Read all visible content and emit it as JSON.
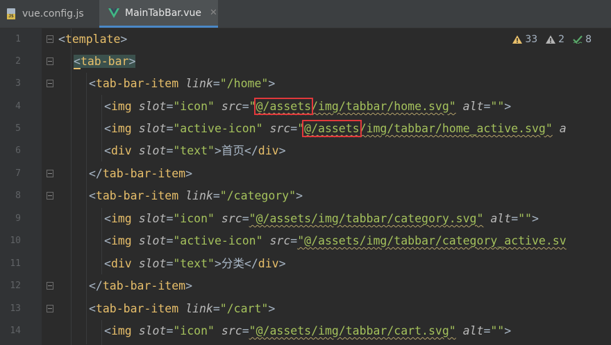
{
  "tabs": [
    {
      "label": "vue.config.js",
      "icon": "js-file-icon",
      "active": false
    },
    {
      "label": "MainTabBar.vue",
      "icon": "vue-file-icon",
      "active": true,
      "close": "✕"
    }
  ],
  "js_badge": "JS",
  "inspections": {
    "warnings": "33",
    "weak_warnings": "2",
    "typos": "8"
  },
  "line_numbers": [
    "1",
    "2",
    "3",
    "4",
    "5",
    "6",
    "7",
    "8",
    "9",
    "10",
    "11",
    "12",
    "13",
    "14"
  ],
  "code": {
    "l1": {
      "open": "<",
      "tag": "template",
      "close": ">"
    },
    "l2": {
      "open": "<",
      "tag": "tab-bar",
      "close": ">"
    },
    "l3": {
      "open": "<",
      "tag": "tab-bar-item",
      "attr": "link",
      "eq": "=",
      "val": "\"/home\"",
      "close": ">"
    },
    "l4": {
      "open": "<",
      "tag": "img",
      "a1": "slot",
      "eq1": "=",
      "v1": "\"icon\"",
      "a2": "src",
      "eq2": "=",
      "v2a": "\"",
      "v2b": "@/assets",
      "v2c": "/img/tabbar/home.svg\"",
      "a3": "alt",
      "eq3": "=",
      "v3": "\"\"",
      "close": ">"
    },
    "l5": {
      "open": "<",
      "tag": "img",
      "a1": "slot",
      "eq1": "=",
      "v1": "\"active-icon\"",
      "a2": "src",
      "eq2": "=",
      "v2a": "\"",
      "v2b": "@/assets",
      "v2c": "/img/tabbar/home_active.svg\"",
      "a3": "a"
    },
    "l6": {
      "open": "<",
      "tag": "div",
      "a1": "slot",
      "eq1": "=",
      "v1": "\"text\"",
      "close1": ">",
      "text": "首页",
      "end_open": "</",
      "end_tag": "div",
      "end_close": ">"
    },
    "l7": {
      "open": "</",
      "tag": "tab-bar-item",
      "close": ">"
    },
    "l8": {
      "open": "<",
      "tag": "tab-bar-item",
      "attr": "link",
      "eq": "=",
      "val": "\"/category\"",
      "close": ">"
    },
    "l9": {
      "open": "<",
      "tag": "img",
      "a1": "slot",
      "eq1": "=",
      "v1": "\"icon\"",
      "a2": "src",
      "eq2": "=",
      "v2": "\"@/assets/img/tabbar/category.svg\"",
      "a3": "alt",
      "eq3": "=",
      "v3": "\"\"",
      "close": ">"
    },
    "l10": {
      "open": "<",
      "tag": "img",
      "a1": "slot",
      "eq1": "=",
      "v1": "\"active-icon\"",
      "a2": "src",
      "eq2": "=",
      "v2": "\"@/assets/img/tabbar/category_active.sv"
    },
    "l11": {
      "open": "<",
      "tag": "div",
      "a1": "slot",
      "eq1": "=",
      "v1": "\"text\"",
      "close1": ">",
      "text": "分类",
      "end_open": "</",
      "end_tag": "div",
      "end_close": ">"
    },
    "l12": {
      "open": "</",
      "tag": "tab-bar-item",
      "close": ">"
    },
    "l13": {
      "open": "<",
      "tag": "tab-bar-item",
      "attr": "link",
      "eq": "=",
      "val": "\"/cart\"",
      "close": ">"
    },
    "l14": {
      "open": "<",
      "tag": "img",
      "a1": "slot",
      "eq1": "=",
      "v1": "\"icon\"",
      "a2": "src",
      "eq2": "=",
      "v2": "\"@/assets/img/tabbar/cart.svg\"",
      "a3": "alt",
      "eq3": "=",
      "v3": "\"\"",
      "close": ">"
    }
  },
  "colors": {
    "tag": "#e8bf6a",
    "attr": "#bababa",
    "value": "#a5c25c",
    "highlight": "#e2383b",
    "vue_green": "#41b883"
  }
}
